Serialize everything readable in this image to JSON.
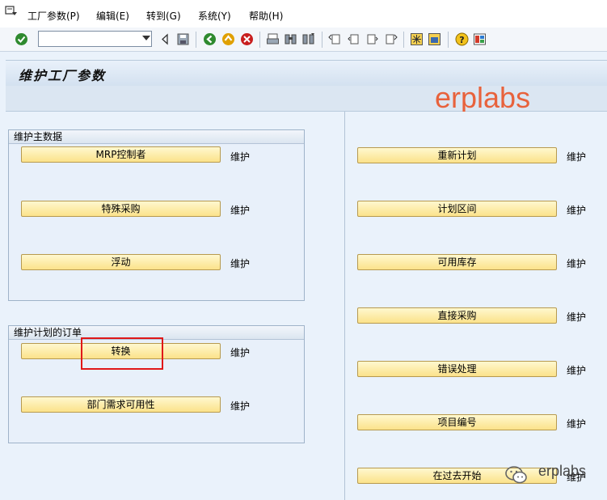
{
  "menu": {
    "items": [
      {
        "label": "工厂参数(P)"
      },
      {
        "label": "编辑(E)"
      },
      {
        "label": "转到(G)"
      },
      {
        "label": "系统(Y)"
      },
      {
        "label": "帮助(H)"
      }
    ]
  },
  "toolbar": {
    "command_field_value": ""
  },
  "screen": {
    "title": "维护工厂参数"
  },
  "watermark": {
    "top_text": "erplabs",
    "bottom_text": "erplabs"
  },
  "groups": {
    "master_data": {
      "title": "维护主数据",
      "buttons": [
        {
          "label": "MRP控制者",
          "action": "维护"
        },
        {
          "label": "特殊采购",
          "action": "维护"
        },
        {
          "label": "浮动",
          "action": "维护"
        }
      ]
    },
    "planned_orders": {
      "title": "维护计划的订单",
      "buttons": [
        {
          "label": "转换",
          "action": "维护"
        },
        {
          "label": "部门需求可用性",
          "action": "维护"
        }
      ]
    }
  },
  "right_buttons": [
    {
      "label": "重新计划",
      "action": "维护"
    },
    {
      "label": "计划区间",
      "action": "维护"
    },
    {
      "label": "可用库存",
      "action": "维护"
    },
    {
      "label": "直接采购",
      "action": "维护"
    },
    {
      "label": "错误处理",
      "action": "维护"
    },
    {
      "label": "项目编号",
      "action": "维护"
    },
    {
      "label": "在过去开始",
      "action": "维护"
    }
  ],
  "colors": {
    "button_fill": "#fbe28a",
    "highlight_border": "#e01818",
    "watermark": "#e8623c"
  }
}
